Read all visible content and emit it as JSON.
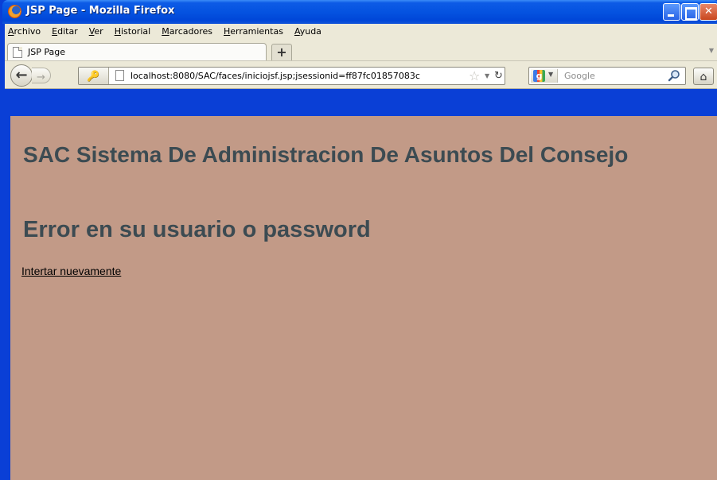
{
  "window": {
    "title": "JSP Page - Mozilla Firefox"
  },
  "menubar": {
    "items": [
      {
        "accel": "A",
        "rest": "rchivo"
      },
      {
        "accel": "E",
        "rest": "ditar"
      },
      {
        "accel": "V",
        "rest": "er"
      },
      {
        "accel": "H",
        "rest": "istorial"
      },
      {
        "accel": "M",
        "rest": "arcadores"
      },
      {
        "accel": "H",
        "rest": "erramientas"
      },
      {
        "accel": "A",
        "rest": "yuda"
      }
    ]
  },
  "tabs": {
    "active_label": "JSP Page",
    "new_tab_label": "+"
  },
  "navbar": {
    "url": "localhost:8080/SAC/faces/iniciojsf.jsp;jsessionid=ff87fc01857083c",
    "search_placeholder": "Google"
  },
  "page": {
    "title": "SAC Sistema De Administracion De Asuntos Del Consejo",
    "error_heading": "Error en su usuario o password",
    "retry_link": "Intertar nuevamente"
  },
  "colors": {
    "page_background": "#c29a87",
    "heading_text": "#3c4b52",
    "titlebar_blue": "#0553e0",
    "chrome_gray": "#ece9d8"
  }
}
